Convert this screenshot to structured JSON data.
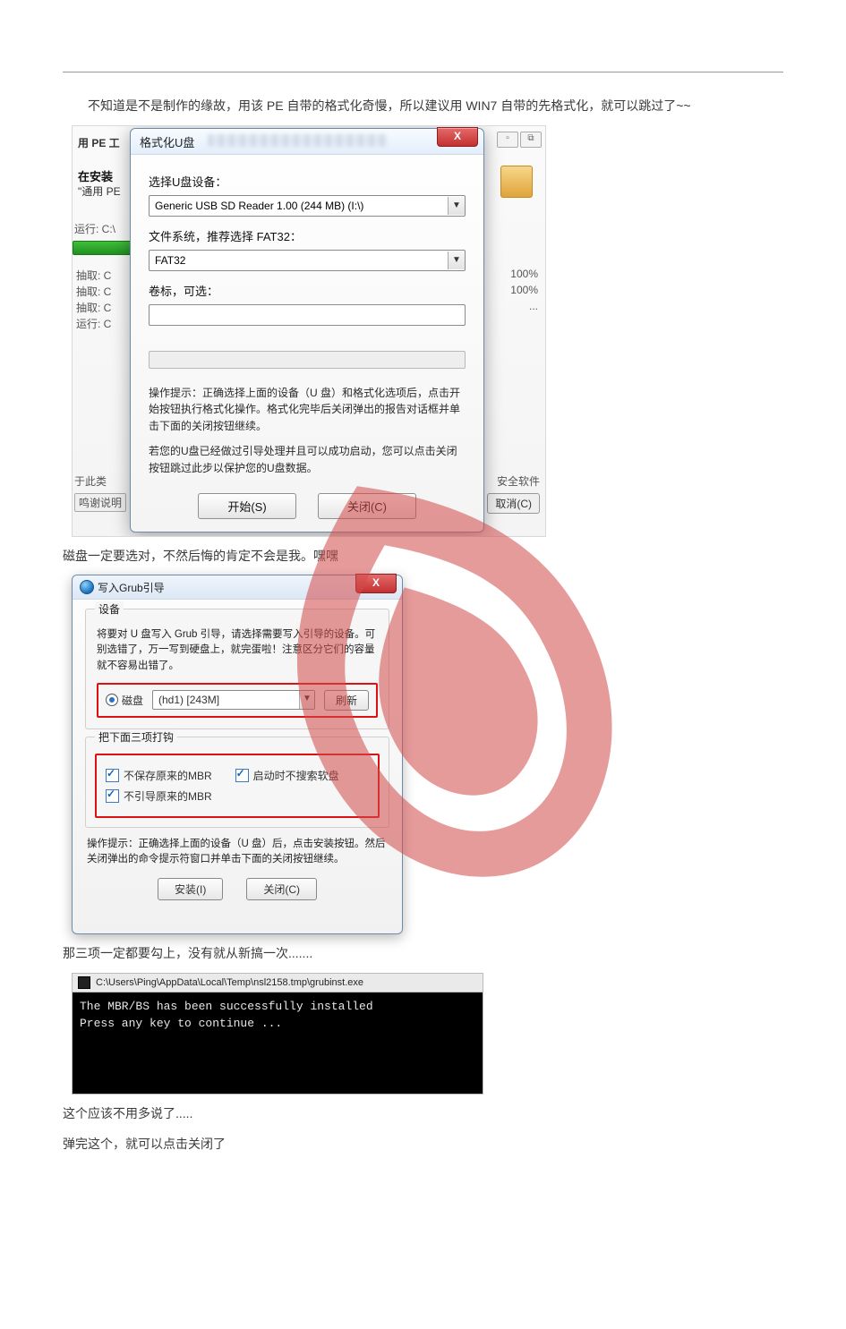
{
  "paragraphs": {
    "p1": "不知道是不是制作的缘故，用该 PE 自带的格式化奇慢，所以建议用 WIN7 自带的先格式化，就可以跳过了~~",
    "p2": "磁盘一定要选对，不然后悔的肯定不会是我。嘿嘿",
    "p3": "那三项一定都要勾上，没有就从新搞一次.......",
    "p4": "这个应该不用多说了.....",
    "p5": "弹完这个，就可以点击关闭了"
  },
  "dialog1": {
    "title": "格式化U盘",
    "label_device": "选择U盘设备：",
    "device_value": "Generic USB  SD Reader 1.00 (244 MB) (I:\\)",
    "label_fs": "文件系统，推荐选择 FAT32：",
    "fs_value": "FAT32",
    "label_volume": "卷标，可选：",
    "hint1": "操作提示：正确选择上面的设备（U 盘）和格式化选项后，点击开始按钮执行格式化操作。格式化完毕后关闭弹出的报告对话框并单击下面的关闭按钮继续。",
    "hint2": "若您的U盘已经做过引导处理并且可以成功启动，您可以点击关闭按钮跳过此步以保护您的U盘数据。",
    "btn_start": "开始(S)",
    "btn_close": "关闭(C)"
  },
  "bg_window": {
    "title_left": "用 PE 工",
    "sub1": "在安装",
    "sub2": "\"通用 PE",
    "run": "运行: C:\\",
    "lines": [
      "抽取: C",
      "抽取: C",
      "抽取: C",
      "运行: C"
    ],
    "pct": [
      "100%",
      "100%",
      "..."
    ],
    "about_left": "于此类",
    "thank_left": "鸣谢说明",
    "right_text": "安全软件",
    "cancel_btn": "取消(C)"
  },
  "dialog2": {
    "title": "写入Grub引导",
    "group_device": "设备",
    "device_text": "将要对 U 盘写入 Grub 引导，请选择需要写入引导的设备。可别选错了，万一写到硬盘上，就完蛋啦！注意区分它们的容量就不容易出错了。",
    "radio_disk": "磁盘",
    "disk_value": "(hd1)  [243M]",
    "btn_refresh": "刷新",
    "group_check": "把下面三项打钩",
    "chk1": "不保存原来的MBR",
    "chk2": "启动时不搜索软盘",
    "chk3": "不引导原来的MBR",
    "hint": "操作提示：正确选择上面的设备（U 盘）后，点击安装按钮。然后关闭弹出的命令提示符窗口并单击下面的关闭按钮继续。",
    "btn_install": "安装(I)",
    "btn_close": "关闭(C)"
  },
  "console": {
    "path": "C:\\Users\\Ping\\AppData\\Local\\Temp\\nsl2158.tmp\\grubinst.exe",
    "line1": "The MBR/BS has been successfully installed",
    "line2": "Press any key to continue ..."
  }
}
